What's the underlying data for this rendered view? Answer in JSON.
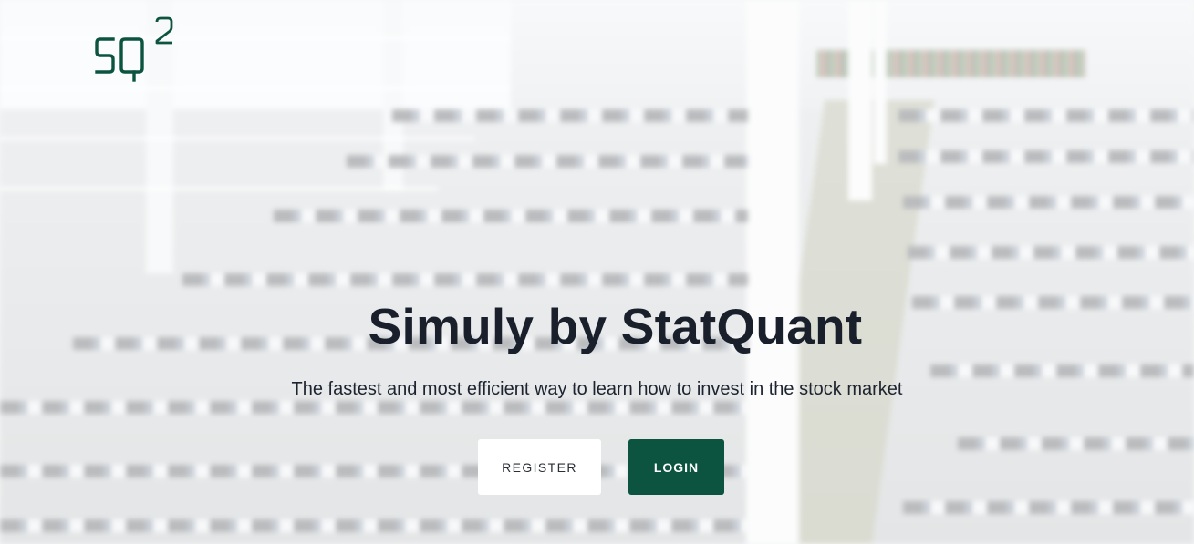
{
  "brand": {
    "logo_icon": "sq2-logo-icon",
    "logo_text": "SQ",
    "logo_superscript": "2",
    "logo_color": "#0d5440"
  },
  "hero": {
    "title": "Simuly by StatQuant",
    "subtitle": "The fastest and most efficient way to learn how to invest in the stock market"
  },
  "actions": {
    "register_label": "REGISTER",
    "login_label": "LOGIN",
    "login_color": "#0d5440",
    "register_color": "#ffffff"
  }
}
